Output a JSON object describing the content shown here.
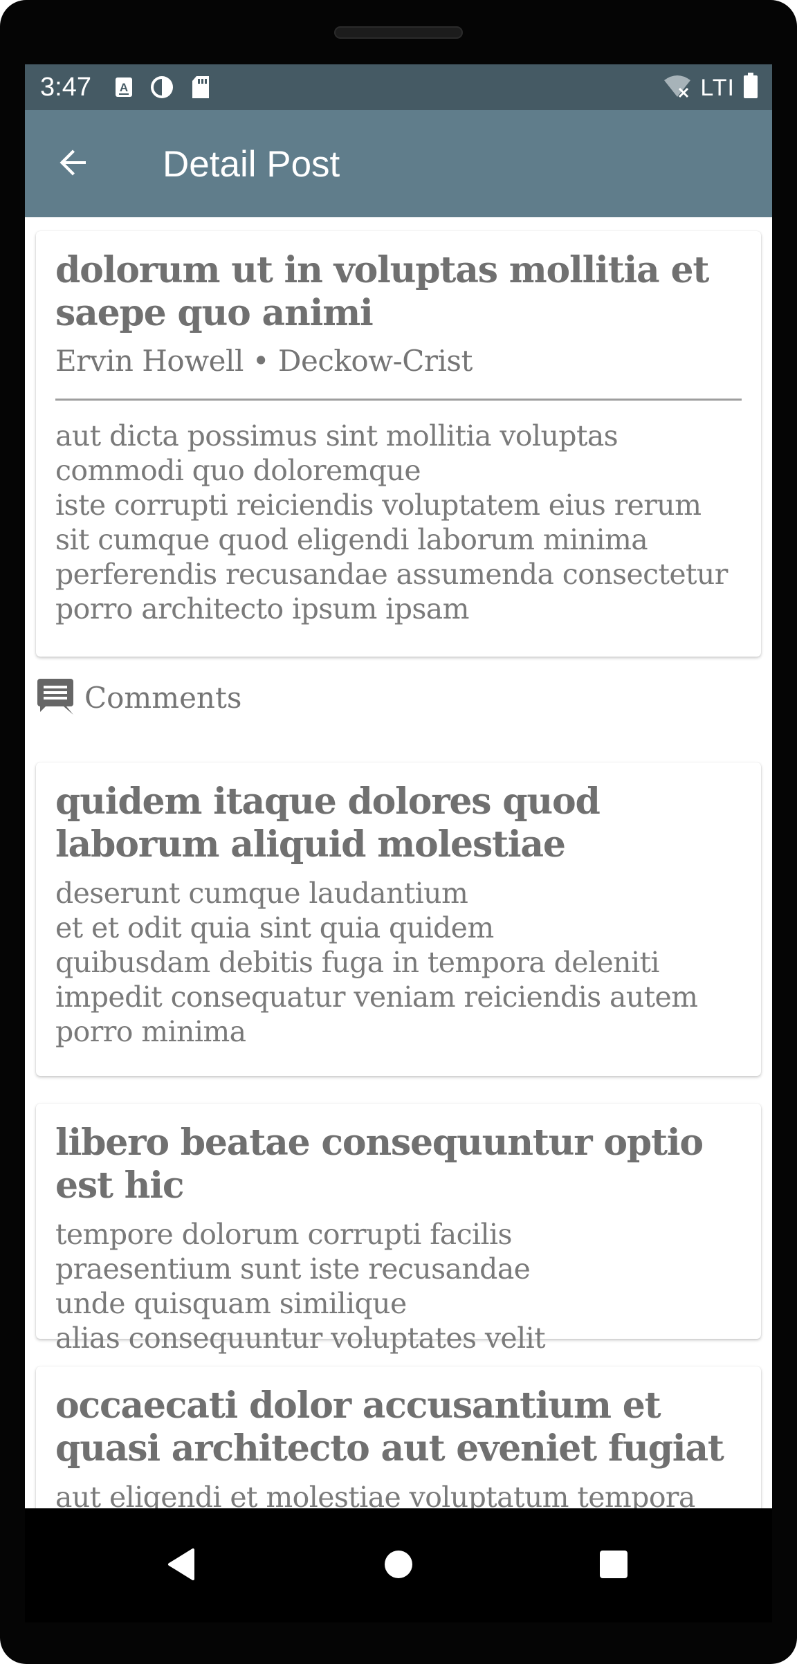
{
  "status_bar": {
    "time": "3:47",
    "network_label": "LTI",
    "icons_left": [
      "a-icon",
      "dnd-icon",
      "sd-card-icon"
    ],
    "icons_right": [
      "wifi-off-icon",
      "battery-icon"
    ]
  },
  "app_bar": {
    "title": "Detail Post",
    "back_icon": "arrow-back-icon",
    "background": "#607d8b"
  },
  "post": {
    "title": "dolorum ut in voluptas mollitia et saepe quo animi",
    "meta": "Ervin Howell • Deckow-Crist",
    "body": "aut dicta possimus sint mollitia voluptas commodi quo doloremque\niste corrupti reiciendis voluptatem eius rerum\nsit cumque quod eligendi laborum minima\nperferendis recusandae assumenda consectetur porro architecto ipsum ipsam"
  },
  "comments_section": {
    "label": "Comments",
    "icon": "comment-icon"
  },
  "comments": [
    {
      "title": "quidem itaque dolores quod laborum aliquid molestiae",
      "body": "deserunt cumque laudantium\net et odit quia sint quia quidem\nquibusdam debitis fuga in tempora deleniti\nimpedit consequatur veniam reiciendis autem porro minima"
    },
    {
      "title": "libero beatae consequuntur optio est hic",
      "body": "tempore dolorum corrupti facilis\npraesentium sunt iste recusandae\nunde quisquam similique\nalias consequuntur voluptates velit"
    },
    {
      "title": "occaecati dolor accusantium et quasi architecto aut eveniet fugiat",
      "body": "aut eligendi et molestiae voluptatum tempora"
    }
  ],
  "nav_bar": {
    "buttons": [
      "back-triangle-icon",
      "home-circle-icon",
      "recents-square-icon"
    ]
  },
  "colors": {
    "status_bar": "#455a64",
    "app_bar": "#607d8b",
    "text": "#707070"
  }
}
